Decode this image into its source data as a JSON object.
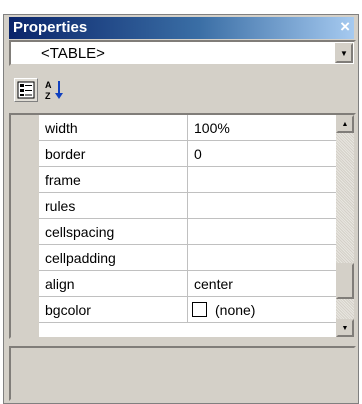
{
  "window": {
    "title": "Properties",
    "close_glyph": "×"
  },
  "object_selector": {
    "selected": "<TABLE>"
  },
  "toolbar": {
    "categorized_icon": "categorized-icon",
    "alphabetical_icon": "alphabetical-sort-icon"
  },
  "properties": [
    {
      "name": "width",
      "value": "100%"
    },
    {
      "name": "border",
      "value": "0"
    },
    {
      "name": "frame",
      "value": ""
    },
    {
      "name": "rules",
      "value": ""
    },
    {
      "name": "cellspacing",
      "value": ""
    },
    {
      "name": "cellpadding",
      "value": ""
    },
    {
      "name": "align",
      "value": "center"
    },
    {
      "name": "bgcolor",
      "value": "(none)",
      "swatch_color": "#ffffff"
    }
  ],
  "colors": {
    "title_start": "#0a246a",
    "title_end": "#a6caf0",
    "chrome": "#d4d0c8"
  }
}
